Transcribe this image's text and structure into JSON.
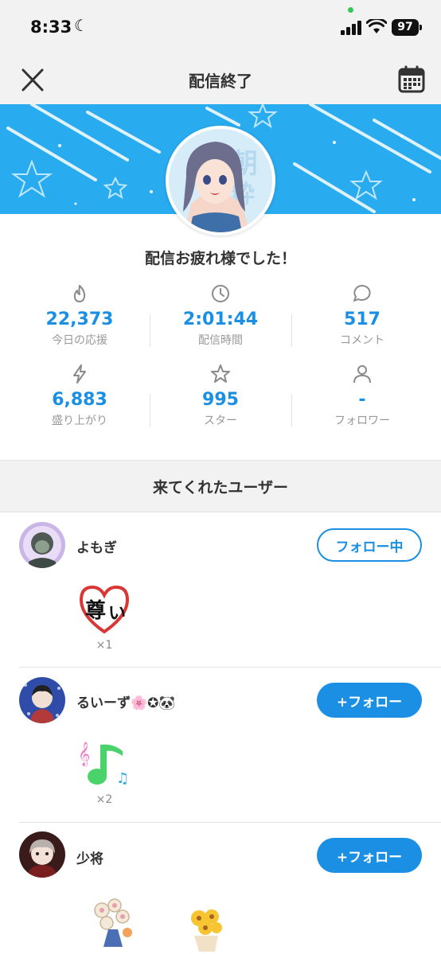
{
  "status_bar": {
    "time": "8:33",
    "battery": "97"
  },
  "nav": {
    "title": "配信終了"
  },
  "headline": "配信お疲れ様でした！",
  "stats": [
    {
      "icon": "flame-icon",
      "value": "22,373",
      "label": "今日の応援"
    },
    {
      "icon": "clock-icon",
      "value": "2:01:44",
      "label": "配信時間"
    },
    {
      "icon": "comment-icon",
      "value": "517",
      "label": "コメント"
    },
    {
      "icon": "lightning-icon",
      "value": "6,883",
      "label": "盛り上がり"
    },
    {
      "icon": "star-icon",
      "value": "995",
      "label": "スター"
    },
    {
      "icon": "person-icon",
      "value": "-",
      "label": "フォロワー"
    }
  ],
  "visitors_section": {
    "title": "来てくれたユーザー"
  },
  "users": [
    {
      "name": "よもぎ",
      "button": "フォロー中",
      "following": true,
      "gifts": [
        {
          "icon": "heart-tōtoi-sticker-icon",
          "count": "×1"
        }
      ]
    },
    {
      "name": "るいーず🌸✪🐼",
      "button": "+フォロー",
      "following": false,
      "gifts": [
        {
          "icon": "music-note-sticker-icon",
          "count": "×2"
        }
      ]
    },
    {
      "name": "少将",
      "button": "+フォロー",
      "following": false,
      "gifts": [
        {
          "icon": "bouquet-sticker-icon"
        },
        {
          "icon": "sunflower-sticker-icon"
        }
      ]
    }
  ],
  "colors": {
    "accent": "#1a8fe3",
    "banner": "#29abef"
  }
}
